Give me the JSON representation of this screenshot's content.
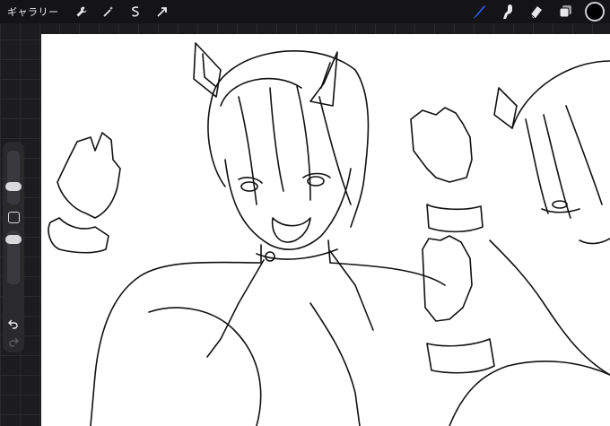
{
  "app": {
    "gallery_label": "ギャラリー"
  },
  "toolbar_left": {
    "icons": [
      "wrench-icon",
      "magic-wand-icon",
      "selection-icon",
      "transform-arrow-icon"
    ]
  },
  "toolbar_right": {
    "icons": [
      "brush-icon",
      "smudge-icon",
      "eraser-icon",
      "layers-icon"
    ],
    "active_tool": "brush",
    "accent_color": "#2f6bff",
    "current_color": "#000000"
  },
  "sidebar": {
    "brush_size_level": 0.3,
    "opacity_level": 0.5,
    "icons": [
      "modify-square-icon",
      "undo-icon",
      "redo-icon"
    ]
  }
}
